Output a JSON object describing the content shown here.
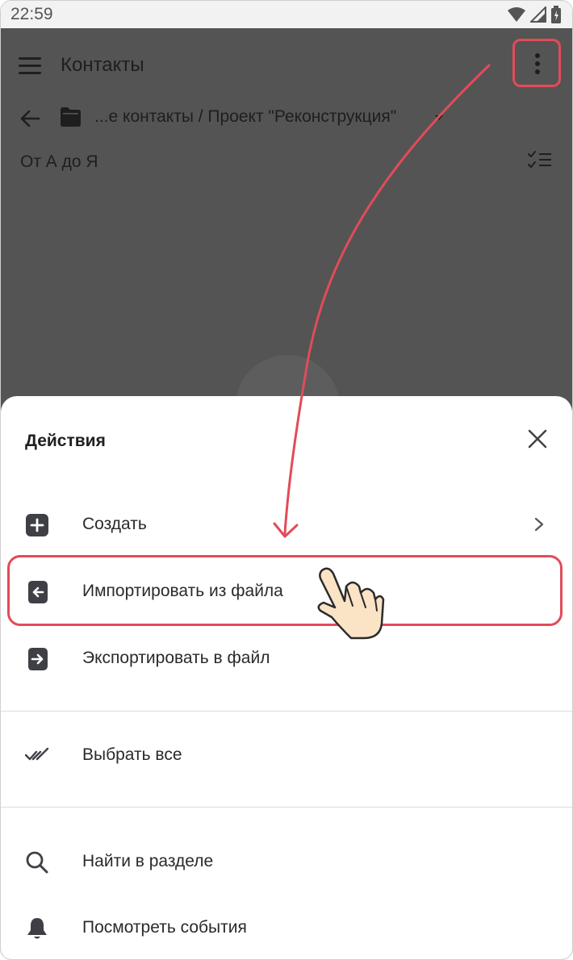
{
  "status_bar": {
    "time": "22:59"
  },
  "toolbar": {
    "title": "Контакты"
  },
  "breadcrumb": {
    "path": "...е контакты / Проект \"Реконструкция\""
  },
  "sort": {
    "label": "От А до Я"
  },
  "sheet": {
    "title": "Действия",
    "items": [
      {
        "label": "Создать",
        "icon": "plus-square-icon",
        "has_submenu": true
      },
      {
        "label": "Импортировать из файла",
        "icon": "import-icon",
        "highlighted": true
      },
      {
        "label": "Экспортировать в файл",
        "icon": "export-icon"
      },
      {
        "label": "Выбрать все",
        "icon": "double-check-icon"
      },
      {
        "label": "Найти в разделе",
        "icon": "search-icon"
      },
      {
        "label": "Посмотреть события",
        "icon": "bell-icon"
      }
    ]
  },
  "colors": {
    "highlight": "#e24b59",
    "dim_background": "#545454",
    "sheet_background": "#ffffff",
    "hand_fill": "#fbe3c6"
  }
}
